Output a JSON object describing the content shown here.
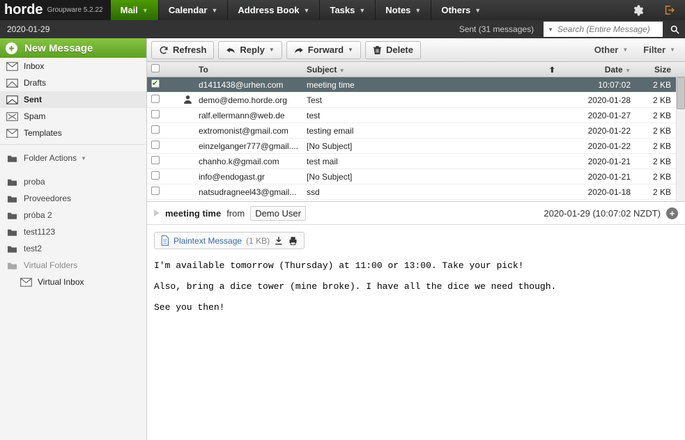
{
  "brand": {
    "name": "horde",
    "tagline": "Groupware 5.2.22"
  },
  "nav": {
    "items": [
      {
        "label": "Mail",
        "active": true
      },
      {
        "label": "Calendar",
        "active": false
      },
      {
        "label": "Address Book",
        "active": false
      },
      {
        "label": "Tasks",
        "active": false
      },
      {
        "label": "Notes",
        "active": false
      },
      {
        "label": "Others",
        "active": false
      }
    ]
  },
  "subbar": {
    "date": "2020-01-29",
    "status": "Sent (31 messages)",
    "search_placeholder": "Search (Entire Message)"
  },
  "sidebar": {
    "newmsg": "New Message",
    "mailboxes": [
      {
        "label": "Inbox",
        "icon": "inbox"
      },
      {
        "label": "Drafts",
        "icon": "drafts"
      },
      {
        "label": "Sent",
        "icon": "sent",
        "selected": true
      },
      {
        "label": "Spam",
        "icon": "spam"
      },
      {
        "label": "Templates",
        "icon": "templates"
      }
    ],
    "folder_actions": "Folder Actions",
    "folders": [
      {
        "label": "proba"
      },
      {
        "label": "Proveedores"
      },
      {
        "label": "próba 2"
      },
      {
        "label": "test1123"
      },
      {
        "label": "test2"
      }
    ],
    "virtual_label": "Virtual Folders",
    "virtual_inbox": "Virtual Inbox"
  },
  "toolbar": {
    "refresh": "Refresh",
    "reply": "Reply",
    "forward": "Forward",
    "delete": "Delete",
    "other": "Other",
    "filter": "Filter"
  },
  "list": {
    "headers": {
      "to": "To",
      "subject": "Subject",
      "date": "Date",
      "size": "Size"
    },
    "rows": [
      {
        "to": "d1411438@urhen.com",
        "subject": "meeting time",
        "date": "10:07:02",
        "size": "2 KB",
        "selected": true,
        "checked": true
      },
      {
        "to": "demo@demo.horde.org",
        "subject": "Test",
        "date": "2020-01-28",
        "size": "2 KB",
        "user": true
      },
      {
        "to": "ralf.ellermann@web.de",
        "subject": "test",
        "date": "2020-01-27",
        "size": "2 KB"
      },
      {
        "to": "extromonist@gmail.com",
        "subject": "testing email",
        "date": "2020-01-22",
        "size": "2 KB"
      },
      {
        "to": "einzelganger777@gmail....",
        "subject": "[No Subject]",
        "date": "2020-01-22",
        "size": "2 KB"
      },
      {
        "to": "chanho.k@gmail.com",
        "subject": "test mail",
        "date": "2020-01-21",
        "size": "2 KB"
      },
      {
        "to": "info@endogast.gr",
        "subject": "[No Subject]",
        "date": "2020-01-21",
        "size": "2 KB"
      },
      {
        "to": "natsudragneel43@gmail...",
        "subject": "ssd",
        "date": "2020-01-18",
        "size": "2 KB"
      }
    ]
  },
  "preview": {
    "subject": "meeting time",
    "from_label": "from",
    "from_user": "Demo User",
    "timestamp": "2020-01-29 (10:07:02 NZDT)",
    "attach_label": "Plaintext Message",
    "attach_size": "(1 KB)",
    "body": "I'm available tomorrow (Thursday) at 11:00 or 13:00. Take your pick!\n\nAlso, bring a dice tower (mine broke). I have all the dice we need though.\n\nSee you then!"
  }
}
